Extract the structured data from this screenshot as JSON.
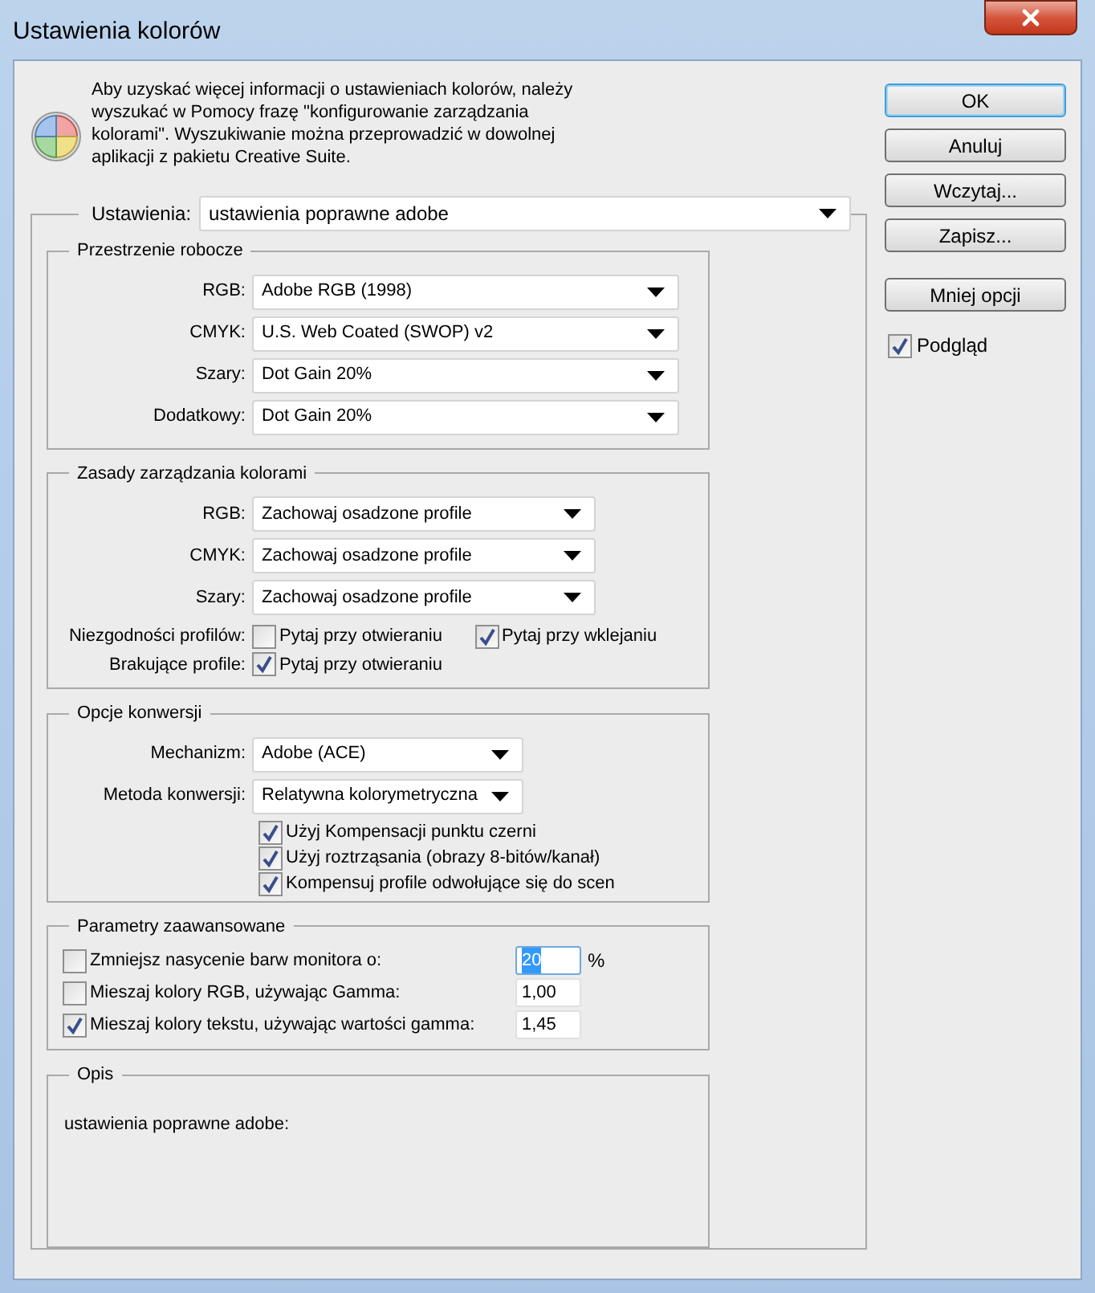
{
  "window": {
    "title": "Ustawienia kolorów"
  },
  "info_text": "Aby uzyskać więcej informacji o ustawieniach kolorów, należy wyszukać w Pomocy frazę \"konfigurowanie zarządzania kolorami\". Wyszukiwanie można przeprowadzić w dowolnej aplikacji z pakietu Creative Suite.",
  "settings": {
    "label": "Ustawienia:",
    "value": "ustawienia poprawne adobe"
  },
  "working_spaces": {
    "title": "Przestrzenie robocze",
    "fields": [
      {
        "label": "RGB:",
        "value": "Adobe RGB (1998)"
      },
      {
        "label": "CMYK:",
        "value": "U.S. Web Coated (SWOP) v2"
      },
      {
        "label": "Szary:",
        "value": "Dot Gain 20%"
      },
      {
        "label": "Dodatkowy:",
        "value": "Dot Gain 20%"
      }
    ]
  },
  "policies": {
    "title": "Zasady zarządzania kolorami",
    "fields": [
      {
        "label": "RGB:",
        "value": "Zachowaj osadzone profile"
      },
      {
        "label": "CMYK:",
        "value": "Zachowaj osadzone profile"
      },
      {
        "label": "Szary:",
        "value": "Zachowaj osadzone profile"
      }
    ],
    "checks": [
      {
        "label": "Niezgodności profilów:",
        "options": [
          {
            "label": "Pytaj przy otwieraniu",
            "checked": false
          },
          {
            "label": "Pytaj przy wklejaniu",
            "checked": true
          }
        ]
      },
      {
        "label": "Brakujące profile:",
        "options": [
          {
            "label": "Pytaj przy otwieraniu",
            "checked": true
          }
        ]
      }
    ]
  },
  "conversion": {
    "title": "Opcje konwersji",
    "fields": [
      {
        "label": "Mechanizm:",
        "value": "Adobe (ACE)"
      },
      {
        "label": "Metoda konwersji:",
        "value": "Relatywna kolorymetryczna"
      }
    ],
    "options": [
      {
        "label": "Użyj Kompensacji punktu czerni",
        "checked": true
      },
      {
        "label": "Użyj roztrząsania (obrazy 8-bitów/kanał)",
        "checked": true
      },
      {
        "label": "Kompensuj profile odwołujące się do scen",
        "checked": true
      }
    ]
  },
  "advanced": {
    "title": "Parametry zaawansowane",
    "rows": [
      {
        "label": "Zmniejsz nasycenie barw monitora o:",
        "checked": false,
        "value": "20",
        "unit": "%",
        "text_selected": true
      },
      {
        "label": "Mieszaj kolory RGB, używając Gamma:",
        "checked": false,
        "value": "1,00",
        "text_selected": false
      },
      {
        "label": "Mieszaj kolory tekstu, używając wartości gamma:",
        "checked": true,
        "value": "1,45",
        "text_selected": false
      }
    ]
  },
  "description": {
    "title": "Opis",
    "text": "ustawienia poprawne adobe:"
  },
  "buttons": [
    {
      "label": "OK",
      "default": true
    },
    {
      "label": "Anuluj",
      "default": false
    },
    {
      "label": "Wczytaj...",
      "default": false
    },
    {
      "label": "Zapisz...",
      "default": false
    }
  ],
  "options_button": {
    "label": "Mniej opcji"
  },
  "preview": {
    "label": "Podgląd",
    "checked": true
  }
}
